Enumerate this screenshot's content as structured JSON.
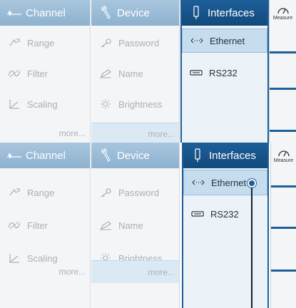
{
  "panels": [
    {
      "id": "top",
      "headers": {
        "channel": "Channel",
        "device": "Device",
        "interfaces": "Interfaces"
      },
      "channel_items": [
        "Range",
        "Filter",
        "Scaling"
      ],
      "channel_more": "more...",
      "device_items": [
        "Password",
        "Name",
        "Brightness"
      ],
      "device_more": "more...",
      "interface_items": [
        "Ethernet",
        "RS232"
      ],
      "measure_label": "Measure"
    },
    {
      "id": "bottom",
      "headers": {
        "channel": "Channel",
        "device": "Device",
        "interfaces": "Interfaces"
      },
      "channel_items": [
        "Range",
        "Filter",
        "Scaling"
      ],
      "channel_more": "more...",
      "device_items": [
        "Password",
        "Name",
        "Brightness"
      ],
      "device_more": "more...",
      "interface_items": [
        "Ethernet",
        "RS232"
      ],
      "measure_label": "Measure"
    }
  ],
  "icons": {
    "channel": "waveform-icon",
    "device": "wrench-icon",
    "interfaces": "usb-plug-icon",
    "range": "range-arrow-icon",
    "filter": "filter-wave-icon",
    "scaling": "scaling-axis-icon",
    "password": "key-icon",
    "name": "pen-icon",
    "brightness": "sun-icon",
    "ethernet": "ethernet-arrows-icon",
    "rs232": "rs232-connector-icon",
    "measure": "gauge-icon"
  },
  "colors": {
    "header_inactive": "#8db1cf",
    "header_active": "#124a7c",
    "selected_row": "#c6dcef",
    "accent": "#1d5f99"
  }
}
